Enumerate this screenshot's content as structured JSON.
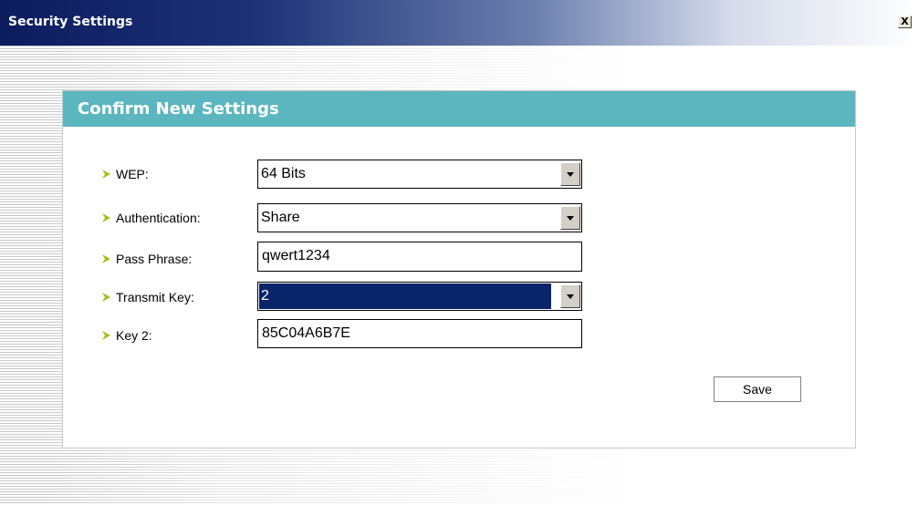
{
  "window": {
    "title": "Security Settings",
    "close_label": "X"
  },
  "panel": {
    "title": "Confirm New Settings"
  },
  "form": {
    "rows": [
      {
        "label": "WEP:",
        "type": "select",
        "value": "64 Bits",
        "selected": false
      },
      {
        "label": "Authentication:",
        "type": "select",
        "value": "Share",
        "selected": false
      },
      {
        "label": "Pass Phrase:",
        "type": "text",
        "value": "qwert1234"
      },
      {
        "label": "Transmit Key:",
        "type": "select",
        "value": "2",
        "selected": true
      },
      {
        "label": "Key 2:",
        "type": "text",
        "value": "85C04A6B7E"
      }
    ],
    "save_label": "Save"
  },
  "colors": {
    "titlebar_start": "#0c1c5e",
    "panel_header": "#5bb6bf",
    "bullet": "#9dc21b",
    "selection": "#0a246a"
  },
  "icons": {
    "bullet": "arrow-bullet-icon",
    "dropdown": "dropdown-arrow-icon",
    "close": "close-icon"
  }
}
